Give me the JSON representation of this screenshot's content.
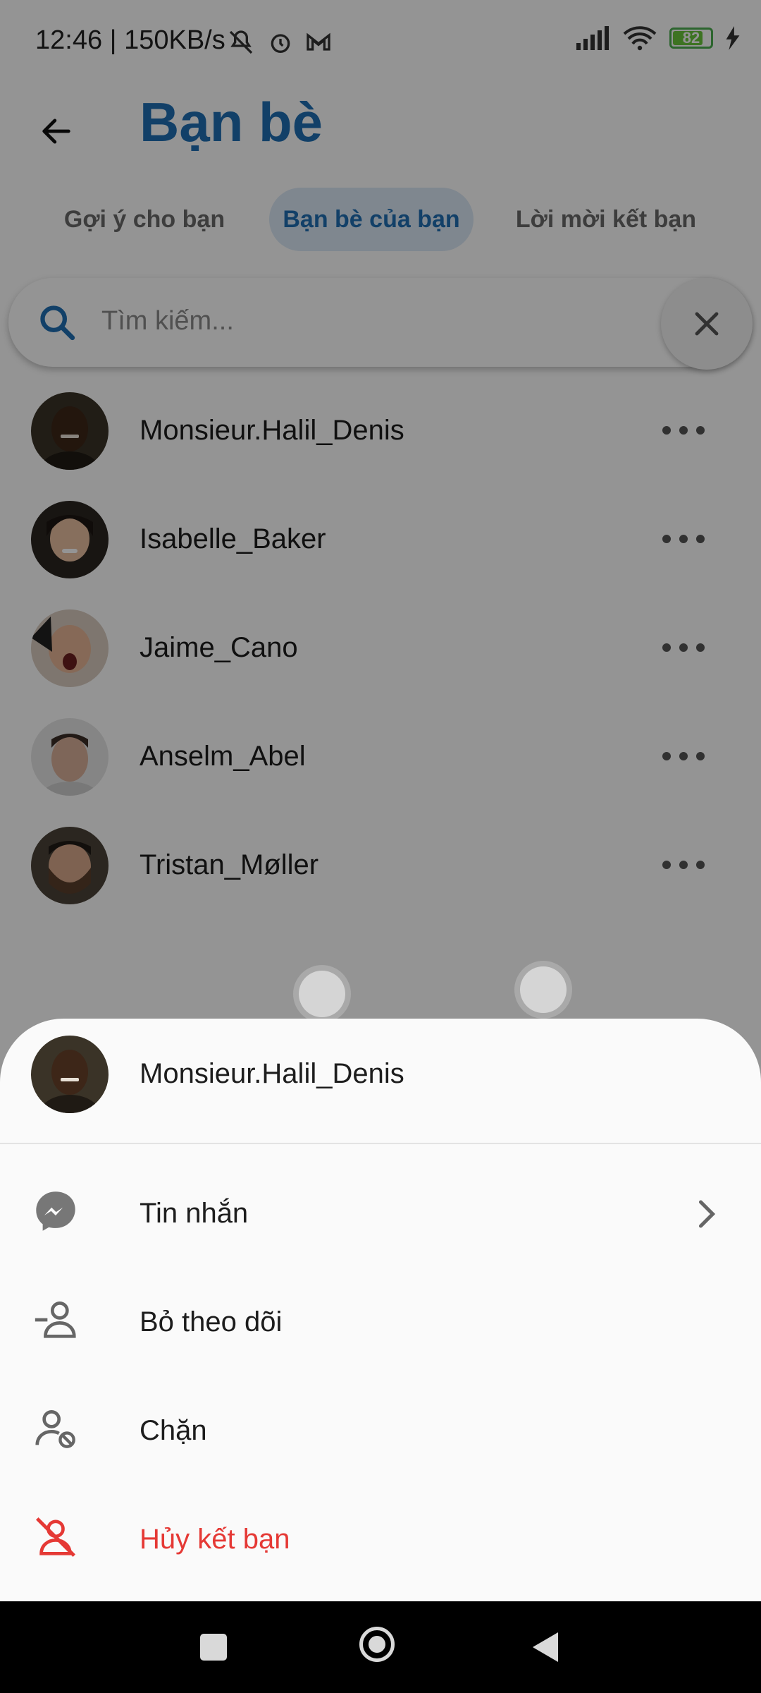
{
  "status_bar": {
    "time": "12:46 | 150KB/s",
    "battery": "82"
  },
  "header": {
    "title": "Bạn bè"
  },
  "tabs": [
    {
      "label": "Gợi ý cho bạn",
      "active": false
    },
    {
      "label": "Bạn bè của bạn",
      "active": true
    },
    {
      "label": "Lời mời kết bạn",
      "active": false
    }
  ],
  "search": {
    "placeholder": "Tìm kiếm..."
  },
  "friends": [
    {
      "name": "Monsieur.Halil_Denis",
      "avatar": "avatar-dark-skin"
    },
    {
      "name": "Isabelle_Baker",
      "avatar": "avatar-woman"
    },
    {
      "name": "Jaime_Cano",
      "avatar": "avatar-excited-man"
    },
    {
      "name": "Anselm_Abel",
      "avatar": "avatar-man"
    },
    {
      "name": "Tristan_Møller",
      "avatar": "avatar-bearded-man"
    }
  ],
  "sheet": {
    "user_name": "Monsieur.Halil_Denis",
    "items": [
      {
        "label": "Tin nhắn",
        "icon": "messenger-icon",
        "has_chevron": true,
        "color": "#1d1d1d"
      },
      {
        "label": "Bỏ theo dõi",
        "icon": "unfollow-icon",
        "has_chevron": false,
        "color": "#1d1d1d"
      },
      {
        "label": "Chặn",
        "icon": "block-user-icon",
        "has_chevron": false,
        "color": "#1d1d1d"
      },
      {
        "label": "Hủy kết bạn",
        "icon": "unfriend-icon",
        "has_chevron": false,
        "color": "#e53935"
      }
    ]
  },
  "colors": {
    "accent": "#1f6fb4",
    "danger": "#e53935",
    "tab_active_bg": "#dbe8f6"
  }
}
